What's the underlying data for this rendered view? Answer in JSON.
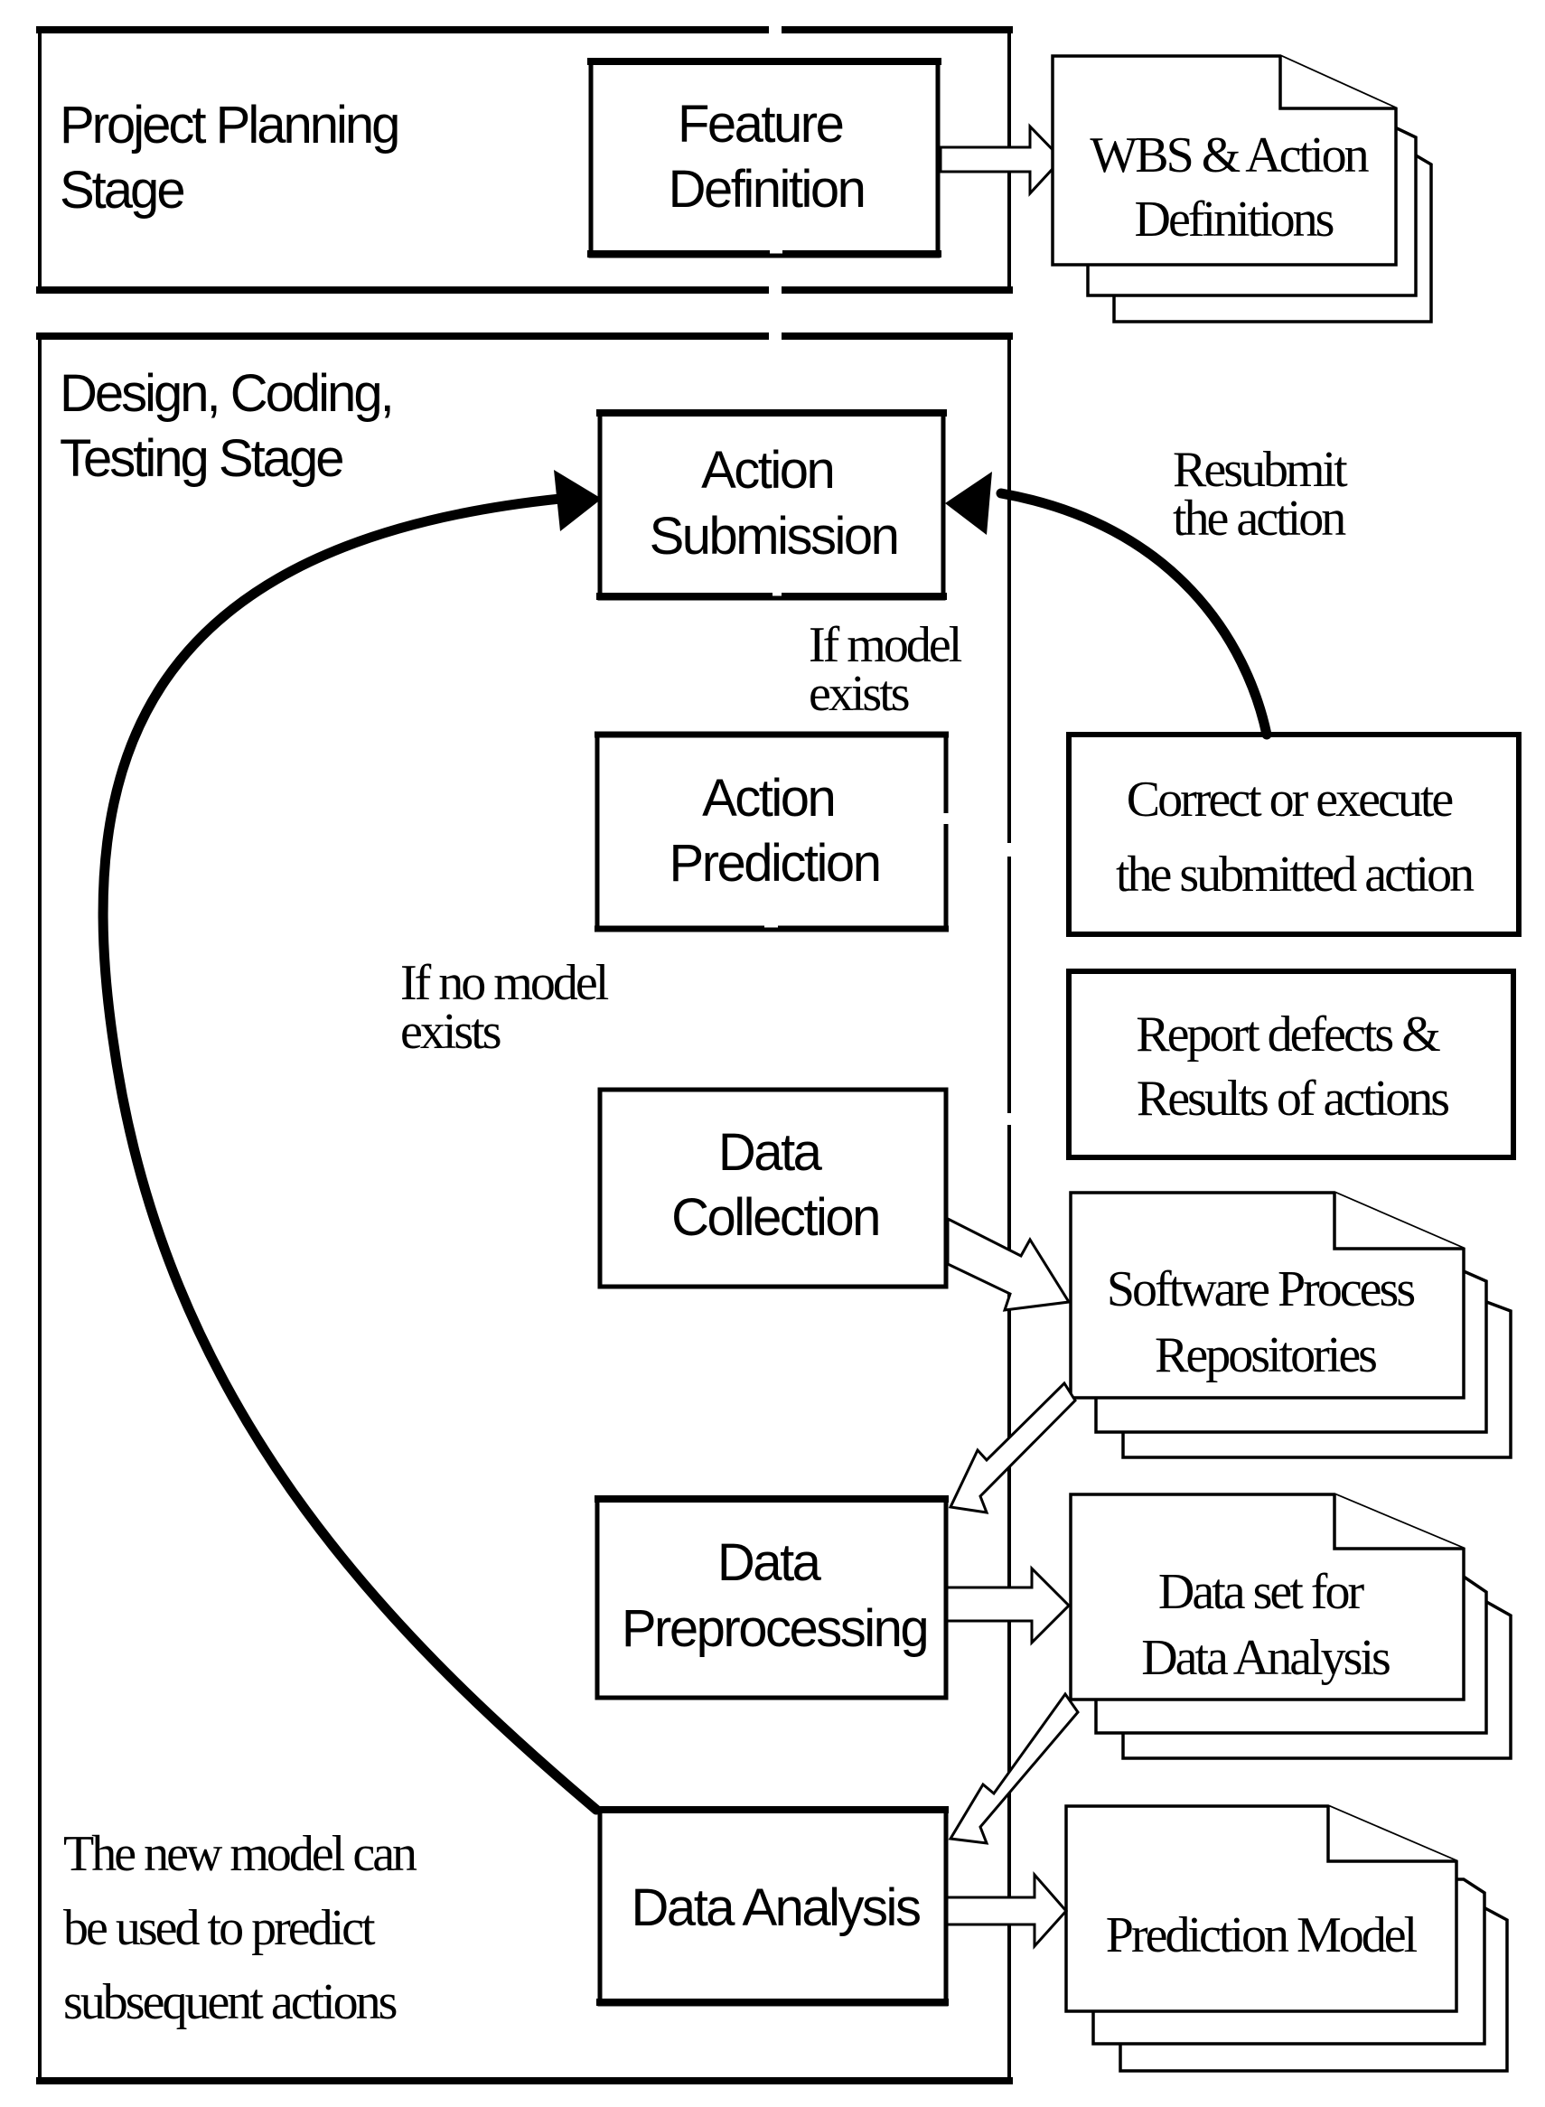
{
  "diagram": {
    "stages": [
      {
        "id": "planning",
        "label_lines": [
          "Project Planning",
          "Stage"
        ]
      },
      {
        "id": "dev",
        "label_lines": [
          "Design, Coding,",
          "Testing Stage"
        ]
      }
    ],
    "processes": {
      "feature_definition": [
        "Feature",
        "Definition"
      ],
      "action_submission": [
        "Action",
        "Submission"
      ],
      "action_prediction": [
        "Action",
        "Prediction"
      ],
      "data_collection": [
        "Data",
        "Collection"
      ],
      "data_preprocessing": [
        "Data",
        "Preprocessing"
      ],
      "data_analysis": [
        "Data Analysis"
      ]
    },
    "external_boxes": {
      "correct_execute": [
        "Correct or execute",
        "the submitted action"
      ],
      "report_defects": [
        "Report defects &",
        "Results of actions"
      ]
    },
    "documents": {
      "wbs": [
        "WBS & Action",
        "Definitions"
      ],
      "repositories": [
        "Software Process",
        "Repositories"
      ],
      "dataset": [
        "Data set for",
        "Data Analysis"
      ],
      "prediction_model": [
        "Prediction Model"
      ]
    },
    "annotations": {
      "resubmit": [
        "Resubmit",
        "the action"
      ],
      "if_model_exists": [
        "If model",
        "exists"
      ],
      "if_no_model": [
        "If no model",
        "exists"
      ],
      "new_model": [
        "The new model can",
        "be used to predict",
        "subsequent actions"
      ]
    },
    "connections": [
      {
        "from": "Feature Definition",
        "to": "WBS & Action Definitions",
        "style": "hollow-arrow"
      },
      {
        "from": "Correct or execute the submitted action",
        "to": "Action Submission",
        "style": "curved-solid",
        "label": "Resubmit the action"
      },
      {
        "from": "Data Analysis",
        "to": "Action Submission",
        "style": "curved-solid"
      },
      {
        "from": "Data Collection",
        "to": "Software Process Repositories",
        "style": "hollow-arrow"
      },
      {
        "from": "Software Process Repositories",
        "to": "Data Preprocessing",
        "style": "hollow-arrow"
      },
      {
        "from": "Data Preprocessing",
        "to": "Data set for Data Analysis",
        "style": "hollow-arrow"
      },
      {
        "from": "Data set for Data Analysis",
        "to": "Data Analysis",
        "style": "hollow-arrow"
      },
      {
        "from": "Data Analysis",
        "to": "Prediction Model",
        "style": "hollow-arrow"
      }
    ]
  }
}
